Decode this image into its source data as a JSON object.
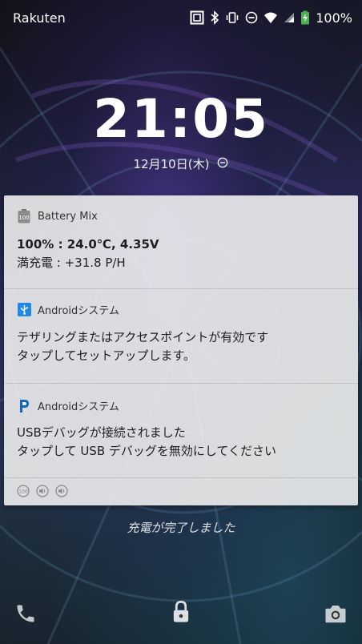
{
  "status_bar": {
    "carrier": "Rakuten",
    "battery_percent": "100%",
    "icons": [
      "nfc-icon",
      "bluetooth-icon",
      "vibrate-icon",
      "dnd-icon",
      "wifi-icon",
      "signal-icon",
      "battery-charging-icon"
    ]
  },
  "lockscreen": {
    "time": "21:05",
    "date": "12月10日(木)",
    "alarm_icon": "dnd-icon"
  },
  "notifications": [
    {
      "app_name": "Battery Mix",
      "icon": "battery-mix-icon",
      "line1": "100% : 24.0℃, 4.35V",
      "line2": "満充電 : +31.8 P/H"
    },
    {
      "app_name": "Androidシステム",
      "icon": "usb-icon",
      "line1": "テザリングまたはアクセスポイントが有効です",
      "line2": "タップしてセットアップします。"
    },
    {
      "app_name": "Androidシステム",
      "icon": "p-icon",
      "line1": "USBデバッグが接続されました",
      "line2": "タップして USB デバッグを無効にしてください"
    }
  ],
  "footer_icons": [
    "battery-mix-small-icon",
    "volume-icon",
    "volume-icon"
  ],
  "charge_status": "充電が完了しました",
  "bottom_shortcuts": [
    "phone-icon",
    "lock-icon",
    "camera-icon"
  ],
  "colors": {
    "panel_bg": "#eeeeee",
    "battery_green": "#4caf50",
    "usb_blue": "#1e88e5",
    "p_blue": "#1565c0"
  }
}
